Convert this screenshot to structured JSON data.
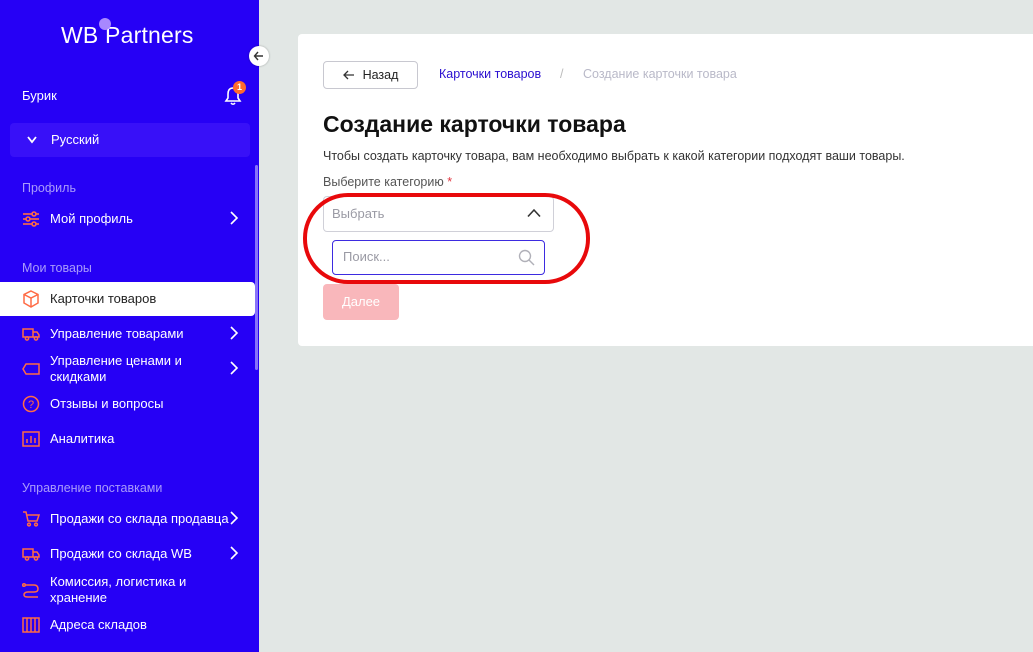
{
  "brand": {
    "wb": "WB",
    "partners": "Partners"
  },
  "user": {
    "name": "Бурик",
    "notifications": "1"
  },
  "language": {
    "label": "Русский"
  },
  "sidebar": {
    "section_profile": "Профиль",
    "my_profile": "Мой профиль",
    "section_goods": "Мои товары",
    "product_cards": "Карточки товаров",
    "goods_management": "Управление товарами",
    "prices_line1": "Управление ценами и",
    "prices_line2": "скидками",
    "reviews": "Отзывы и вопросы",
    "analytics": "Аналитика",
    "section_supplies": "Управление поставками",
    "seller_warehouse": "Продажи со склада продавца",
    "wb_warehouse": "Продажи со склада WB",
    "commission_line1": "Комиссия, логистика и",
    "commission_line2": "хранение",
    "warehouse_addresses": "Адреса складов"
  },
  "main": {
    "back_label": "Назад",
    "breadcrumb_link": "Карточки товаров",
    "breadcrumb_sep": "/",
    "breadcrumb_current": "Создание карточки товара",
    "title": "Создание карточки товара",
    "description": "Чтобы создать карточку товара, вам необходимо выбрать к какой категории подходят ваши товары.",
    "category_label": "Выберите категорию",
    "required_mark": "*",
    "select_placeholder": "Выбрать",
    "search_placeholder": "Поиск...",
    "next_label": "Далее"
  },
  "colors": {
    "sidebar": "#2600f5",
    "accent": "#ff6b2d",
    "highlight": "#e8090b",
    "disabled_button": "#f9b7bb"
  }
}
